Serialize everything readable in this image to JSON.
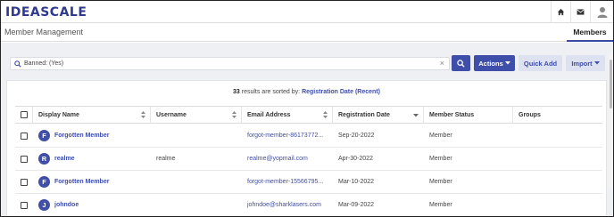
{
  "app": {
    "logo": "IDEASCALE"
  },
  "topbar": {
    "icons": [
      "home-icon",
      "mail-icon",
      "user-avatar-icon"
    ]
  },
  "header": {
    "page_title": "Member Management",
    "active_tab": "Members"
  },
  "search": {
    "filter_text": "Banned: (Yes)",
    "clear_glyph": "×"
  },
  "toolbar": {
    "actions_label": "Actions",
    "quick_add_label": "Quick Add",
    "import_label": "Import"
  },
  "results": {
    "count": "33",
    "sorted_text": "results are sorted by:",
    "sort_key": "Registration Date (Recent)"
  },
  "table": {
    "columns": [
      "Display Name",
      "Username",
      "Email Address",
      "Registration Date",
      "Member Status",
      "Groups"
    ],
    "rows": [
      {
        "initial": "F",
        "display_name": "Forgotten Member",
        "username": "",
        "email": "forgot-member-86173772...",
        "registration_date": "Sep-20-2022",
        "status": "Member",
        "groups": ""
      },
      {
        "initial": "R",
        "display_name": "realme",
        "username": "realme",
        "email": "realme@yopmail.com",
        "registration_date": "Apr-30-2022",
        "status": "Member",
        "groups": ""
      },
      {
        "initial": "F",
        "display_name": "Forgotten Member",
        "username": "",
        "email": "forgot-member-15566795...",
        "registration_date": "Mar-10-2022",
        "status": "Member",
        "groups": ""
      },
      {
        "initial": "J",
        "display_name": "johndoe",
        "username": "",
        "email": "johndoe@sharklasers.com",
        "registration_date": "Mar-09-2022",
        "status": "Member",
        "groups": ""
      }
    ]
  },
  "colors": {
    "accent": "#3f4ea8",
    "light_button": "#dde1f0",
    "background": "#eef0f3"
  }
}
